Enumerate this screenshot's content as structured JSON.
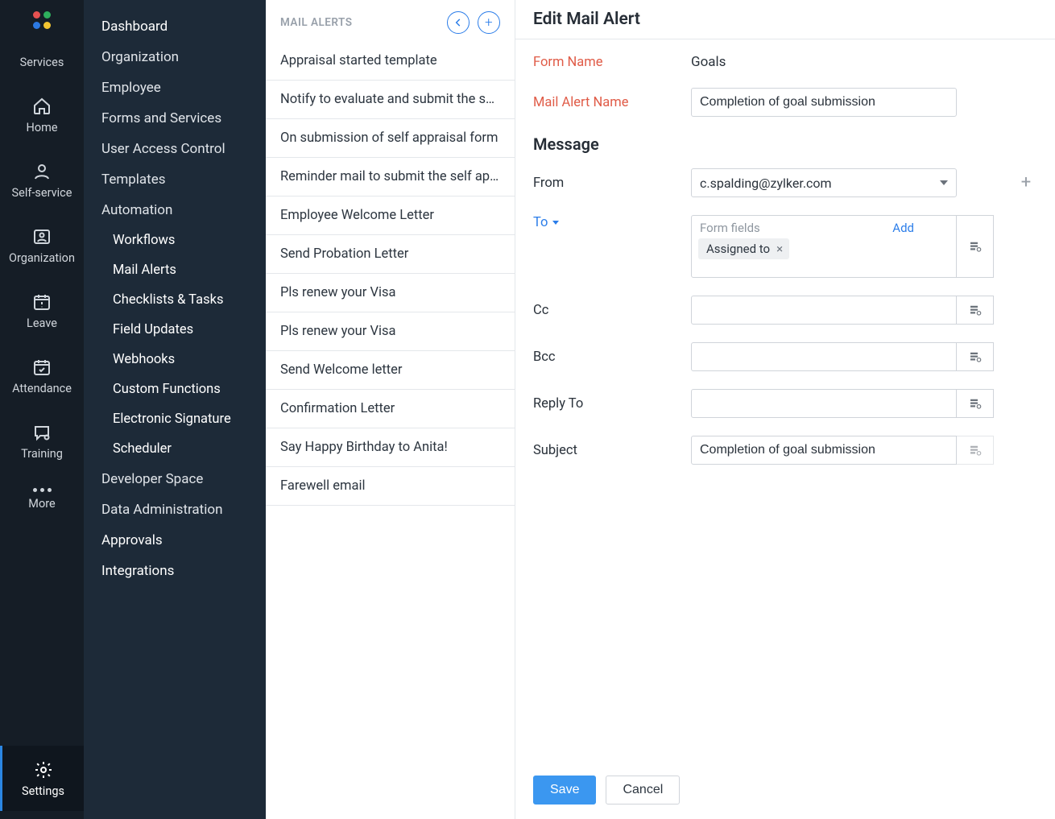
{
  "rail": {
    "items": [
      {
        "id": "services",
        "label": "Services"
      },
      {
        "id": "home",
        "label": "Home"
      },
      {
        "id": "self-service",
        "label": "Self-service"
      },
      {
        "id": "organization",
        "label": "Organization"
      },
      {
        "id": "leave",
        "label": "Leave"
      },
      {
        "id": "attendance",
        "label": "Attendance"
      },
      {
        "id": "training",
        "label": "Training"
      },
      {
        "id": "more",
        "label": "More"
      },
      {
        "id": "settings",
        "label": "Settings",
        "active": true
      }
    ],
    "logo_colors": [
      "#e55151",
      "#2eaf5d",
      "#2c79e2",
      "#f2c431"
    ]
  },
  "sidebar2": {
    "items": [
      {
        "label": "Dashboard",
        "strong": true
      },
      {
        "label": "Organization"
      },
      {
        "label": "Employee"
      },
      {
        "label": "Forms and Services"
      },
      {
        "label": "User Access Control"
      },
      {
        "label": "Templates"
      },
      {
        "label": "Automation",
        "children": [
          {
            "label": "Workflows"
          },
          {
            "label": "Mail Alerts",
            "active": true
          },
          {
            "label": "Checklists & Tasks"
          },
          {
            "label": "Field Updates"
          },
          {
            "label": "Webhooks"
          },
          {
            "label": "Custom Functions"
          },
          {
            "label": "Electronic Signature"
          },
          {
            "label": "Scheduler"
          }
        ]
      },
      {
        "label": "Developer Space"
      },
      {
        "label": "Data Administration"
      },
      {
        "label": "Approvals",
        "strong": true
      },
      {
        "label": "Integrations",
        "strong": true
      }
    ]
  },
  "list": {
    "title": "MAIL ALERTS",
    "items": [
      "Appraisal started template",
      "Notify to evaluate and submit the self a…",
      "On submission of self appraisal form",
      "Reminder mail to submit the self apprai…",
      "Employee Welcome Letter",
      "Send Probation Letter",
      "Pls renew your Visa",
      "Pls renew your Visa",
      "Send Welcome letter",
      "Confirmation Letter",
      "Say Happy Birthday to Anita!",
      "Farewell email"
    ]
  },
  "detail": {
    "title": "Edit Mail Alert",
    "labels": {
      "form_name": "Form Name",
      "mail_alert_name": "Mail Alert Name",
      "message": "Message",
      "from": "From",
      "to": "To",
      "cc": "Cc",
      "bcc": "Bcc",
      "reply_to": "Reply To",
      "subject": "Subject"
    },
    "values": {
      "form_name": "Goals",
      "mail_alert_name": "Completion of goal submission",
      "from": "c.spalding@zylker.com",
      "to_placeholder": "Form fields",
      "to_add": "Add",
      "to_chip": "Assigned to",
      "subject": "Completion of goal submission"
    },
    "buttons": {
      "save": "Save",
      "cancel": "Cancel"
    }
  }
}
